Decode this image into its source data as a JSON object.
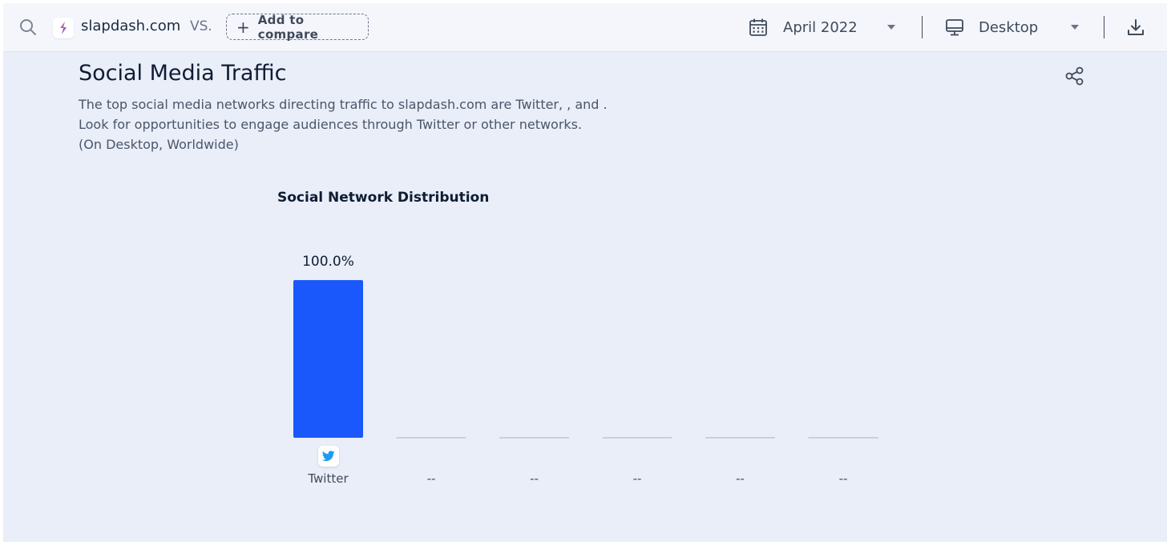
{
  "topbar": {
    "site_name": "slapdash.com",
    "vs_label": "VS.",
    "add_compare_label": "Add to compare",
    "date_value": "April 2022",
    "device_value": "Desktop"
  },
  "section": {
    "title": "Social Media Traffic",
    "description_lines": [
      "The top social media networks directing traffic to slapdash.com are Twitter, , and .",
      "Look for opportunities to engage audiences through Twitter or other networks.",
      "(On Desktop, Worldwide)"
    ]
  },
  "chart_data": {
    "type": "bar",
    "title": "Social Network Distribution",
    "categories": [
      "Twitter",
      "--",
      "--",
      "--",
      "--",
      "--"
    ],
    "values": [
      100.0,
      0,
      0,
      0,
      0,
      0
    ],
    "value_labels": [
      "100.0%",
      "",
      "",
      "",
      "",
      ""
    ],
    "ylim": [
      0,
      100
    ],
    "bar_color": "#1a58fb",
    "empty_bar_color": "#c9d0dc",
    "grid": false,
    "legend": "none"
  },
  "icons": {
    "search": "search-icon",
    "site_logo": "slapdash-logo-icon",
    "calendar": "calendar-icon",
    "monitor": "monitor-icon",
    "download": "download-icon",
    "share": "share-icon",
    "twitter": "twitter-icon"
  },
  "colors": {
    "accent": "#1a58fb",
    "twitter": "#1d9bf0",
    "background": "#e9eef8"
  }
}
